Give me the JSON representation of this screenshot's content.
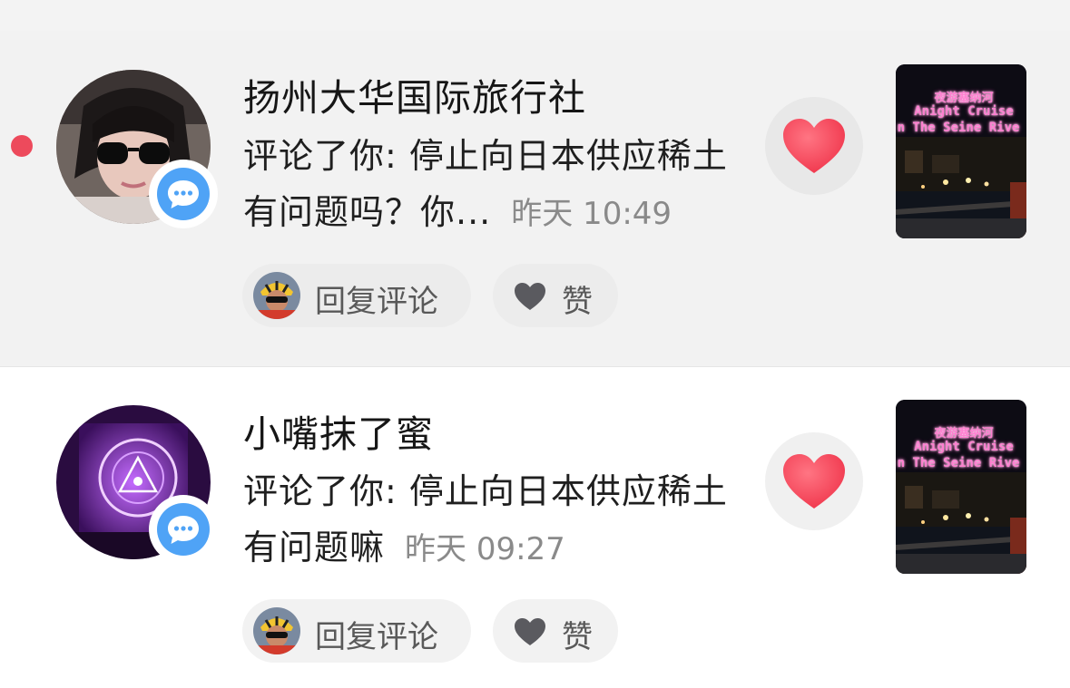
{
  "notifications": [
    {
      "unread": true,
      "name": "扬州大华国际旅行社",
      "comment": "评论了你: 停止向日本供应稀土有问题吗？你...",
      "time": "昨天 10:49",
      "reply_label": "回复评论",
      "like_label": "赞",
      "thumbnail": {
        "line1": "夜游塞纳河",
        "line2": "Anight Cruise",
        "line3": "n The Seine Rive"
      }
    },
    {
      "unread": false,
      "name": "小嘴抹了蜜",
      "comment": "评论了你: 停止向日本供应稀土有问题嘛",
      "time": "昨天 09:27",
      "reply_label": "回复评论",
      "like_label": "赞",
      "thumbnail": {
        "line1": "夜游塞纳河",
        "line2": "Anight Cruise",
        "line3": "n The Seine Rive"
      }
    }
  ],
  "colors": {
    "unread_dot": "#ed4a5c",
    "comment_badge": "#4fa3f6",
    "heart": "#ff4a5e",
    "like_heart": "#5a5a5f"
  },
  "icons": {
    "badge": "comment-bubble-icon",
    "heart_button": "heart-icon",
    "like": "heart-outline-icon"
  }
}
